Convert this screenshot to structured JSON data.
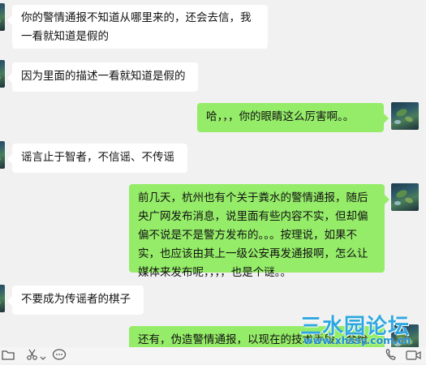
{
  "messages": [
    {
      "side": "left",
      "text": "你的警情通报不知道从哪里来的，还会去信，我一看就知道是假的"
    },
    {
      "side": "left",
      "text": "因为里面的描述一看就知道是假的"
    },
    {
      "side": "right",
      "text": "哈，，，你的眼睛这么厉害啊。。"
    },
    {
      "side": "left",
      "text": "谣言止于智者，不信谣、不传谣"
    },
    {
      "side": "right",
      "text": "前几天，杭州也有个关于粪水的警情通报，随后央广网发布消息，说里面有些内容不实，但却偏偏不说是不是警方发布的。。。按理说，如果不实，也应该由其上一级公安再发通报啊，怎么让媒体来发布呢，，，，也是个谜。。"
    },
    {
      "side": "left",
      "text": "不要成为传谣者的棋子"
    },
    {
      "side": "right",
      "text": "还有，伪造警情通报，以现在的技术手段，会给"
    }
  ],
  "toolbar": {
    "folder_icon": "folder-icon",
    "scissors_icon": "scissors-icon",
    "chat_icon": "chat-icon",
    "phone_icon": "phone-icon",
    "video_icon": "video-icon"
  },
  "watermark": {
    "main": "三水园论坛",
    "url": "www.xhssy.com.cn"
  },
  "colors": {
    "background": "#f1f1f1",
    "left_bubble": "#ffffff",
    "right_bubble": "#95ec69",
    "watermark": "#2ea7e0"
  }
}
